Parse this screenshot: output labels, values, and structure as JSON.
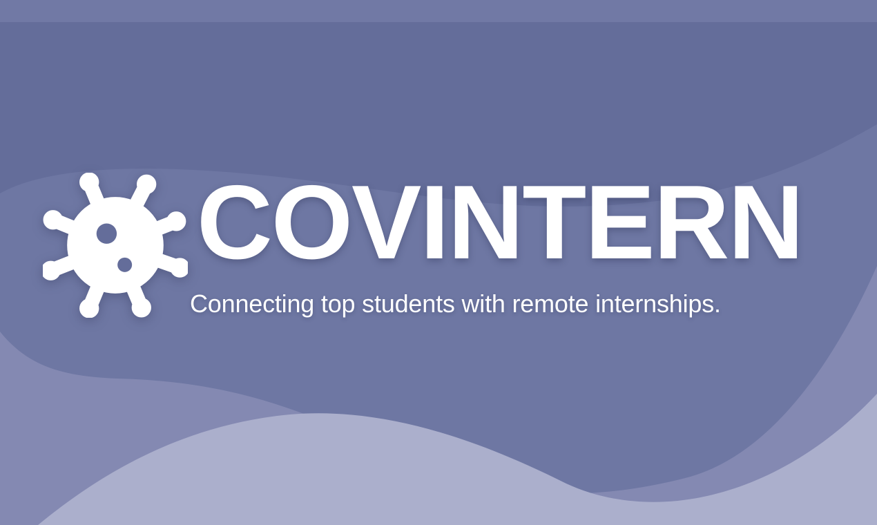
{
  "brand": {
    "name": "COVINTERN",
    "tagline": "Connecting top students with remote internships.",
    "logo_icon": "virus-gear-icon"
  },
  "colors": {
    "background": "#646d9a",
    "top_band": "#7179a5",
    "wave_mid": "#6e77a3",
    "wave_light": "#8489b2",
    "wave_lightest": "#abafcc",
    "text": "#ffffff"
  }
}
